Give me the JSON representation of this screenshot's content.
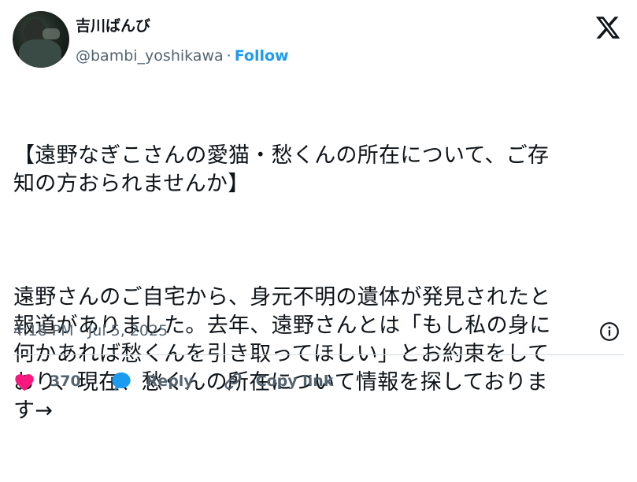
{
  "author": {
    "display_name": "吉川ばんび",
    "handle": "@bambi_yoshikawa",
    "separator": "·",
    "follow_label": "Follow"
  },
  "tweet": {
    "paragraphs": [
      "【遠野なぎこさんの愛猫・愁くんの所在について、ご存\n知の方おられませんか】",
      "遠野さんのご自宅から、身元不明の遺体が発見されたと\n報道がありました。去年、遠野さんとは「もし私の身に\n何かあれば愁くんを引き取ってほしい」とお約束をして\nおり、現在、愁くんの所在について情報を探しておりま\nす→"
    ],
    "timestamp": "4:16 PM · Jul 5, 2025"
  },
  "actions": {
    "like_count": "370",
    "reply_label": "Reply",
    "copy_link_label": "Copy link"
  },
  "icons": {
    "platform": "x-logo-icon",
    "info": "info-icon",
    "like": "heart-icon",
    "reply": "speech-bubble-icon",
    "copy": "link-icon"
  },
  "colors": {
    "accent": "#1d9bf0",
    "like": "#f91880",
    "muted": "#536471",
    "text": "#0f1419"
  }
}
